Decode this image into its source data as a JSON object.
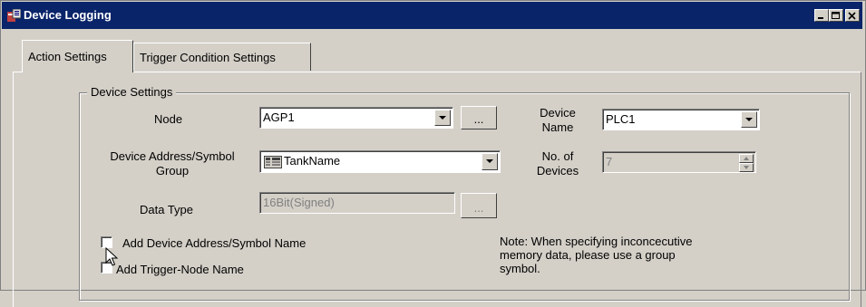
{
  "window": {
    "title": "Device Logging",
    "icon": "device-logging-app-icon"
  },
  "titlebar_buttons": [
    "minimize-icon",
    "maximize-icon",
    "close-icon"
  ],
  "tabs": [
    {
      "label": "Action Settings",
      "active": true
    },
    {
      "label": "Trigger Condition Settings",
      "active": false
    }
  ],
  "device_settings": {
    "group_title": "Device Settings",
    "node": {
      "label": "Node",
      "value": "AGP1",
      "browse_label": "..."
    },
    "device_name": {
      "label_line1": "Device",
      "label_line2": "Name",
      "value": "PLC1"
    },
    "address_group": {
      "label_line1": "Device Address/Symbol",
      "label_line2": "Group",
      "value": "TankName",
      "icon": "symbol-table-icon"
    },
    "no_of_devices": {
      "label_line1": "No. of",
      "label_line2": "Devices",
      "value": "7"
    },
    "data_type": {
      "label": "Data Type",
      "value": "16Bit(Signed)",
      "browse_label": "..."
    },
    "add_symbol_name": {
      "label": "Add Device Address/Symbol Name",
      "checked": false
    },
    "add_trigger_node": {
      "label": "Add Trigger-Node Name",
      "checked": false
    },
    "note_lines": [
      "Note: When specifying inconcecutive",
      "memory data, please use a group",
      "symbol."
    ]
  }
}
